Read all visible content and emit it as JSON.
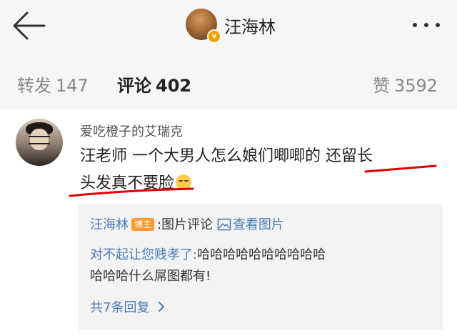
{
  "header": {
    "title": "汪海林"
  },
  "tabs": {
    "repost_label": "转发",
    "repost_count": "147",
    "comments_label": "评论",
    "comments_count": "402",
    "likes_label": "赞",
    "likes_count": "3592"
  },
  "comment": {
    "username": "爱吃橙子的艾瑞克",
    "text_line1": "汪老师 一个大男人怎么娘们唧唧的 还留长",
    "text_line2": "头发真不要脸",
    "emoji": "emoji-smile-icon"
  },
  "reply": {
    "author": "汪海林",
    "badge": "博主",
    "image_comment_label": ":图片评论",
    "view_image_label": "查看图片",
    "mention": "对不起让您贱孝了:",
    "text_part1": "哈哈哈哈哈哈哈哈哈哈",
    "text_part2": "哈哈哈什么屌图都有!",
    "more_replies": "共7条回复"
  },
  "icons": {
    "back": "back-arrow-icon",
    "more": "more-dots-icon",
    "verified": "verified-badge-icon",
    "image": "image-icon",
    "chevron": "chevron-right-icon"
  },
  "colors": {
    "link_blue": "#4a7ab8",
    "badge_orange": "#ff9a2e",
    "underline_red": "#e00000",
    "header_bg": "#f6f6f6"
  }
}
